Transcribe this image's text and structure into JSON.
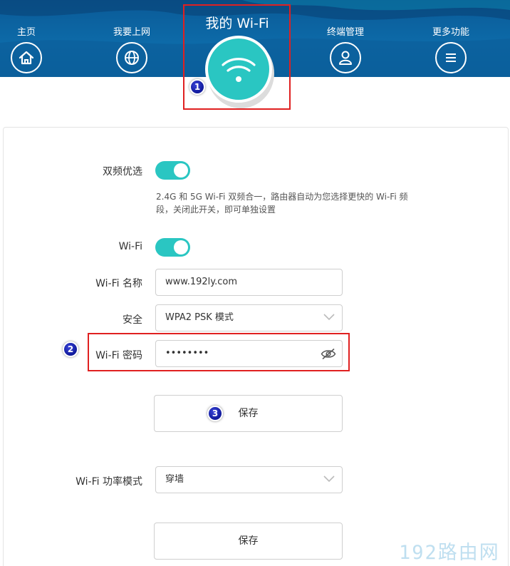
{
  "nav": {
    "items": [
      {
        "label": "主页",
        "icon": "home-icon"
      },
      {
        "label": "我要上网",
        "icon": "globe-icon"
      },
      {
        "label": "终端管理",
        "icon": "user-icon"
      },
      {
        "label": "更多功能",
        "icon": "menu-icon"
      }
    ],
    "active": {
      "label": "我的 Wi-Fi",
      "icon": "wifi-icon"
    }
  },
  "callouts": [
    "1",
    "2",
    "3"
  ],
  "settings": {
    "dual_band": {
      "label": "双频优选",
      "enabled": true,
      "hint_line1": "2.4G 和 5G Wi-Fi 双频合一，路由器自动为您选择更快的 Wi-Fi 频",
      "hint_line2": "段，关闭此开关，即可单独设置"
    },
    "wifi": {
      "label": "Wi-Fi",
      "enabled": true
    },
    "wifi_name": {
      "label": "Wi-Fi 名称",
      "value": "www.192ly.com"
    },
    "security": {
      "label": "安全",
      "value": "WPA2 PSK 模式"
    },
    "wifi_password": {
      "label": "Wi-Fi 密码",
      "value": "••••••••"
    },
    "save_label": "保存",
    "power_mode": {
      "label": "Wi-Fi 功率模式",
      "value": "穿墙"
    },
    "save2_label": "保存"
  },
  "watermark": "192路由网",
  "colors": {
    "header": "#0d6aa8",
    "accent": "#2ac6c2",
    "highlight": "#e02020",
    "badge": "#10199a"
  }
}
